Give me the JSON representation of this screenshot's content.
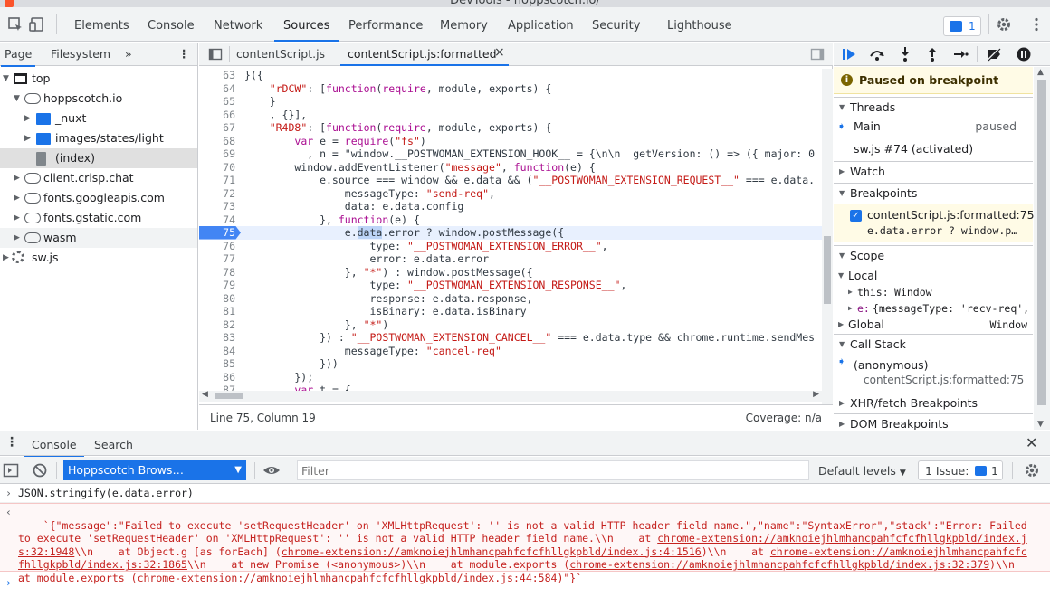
{
  "window": {
    "title": "DevTools - hoppscotch.io/"
  },
  "main_tabs": [
    "Elements",
    "Console",
    "Network",
    "Sources",
    "Performance",
    "Memory",
    "Application",
    "Security",
    "Lighthouse"
  ],
  "issues_badge": "1",
  "navigator": {
    "tabs": [
      "Page",
      "Filesystem"
    ],
    "overflow": "»",
    "tree": [
      {
        "label": "top"
      },
      {
        "label": "hoppscotch.io"
      },
      {
        "label": "_nuxt"
      },
      {
        "label": "images/states/light"
      },
      {
        "label": "(index)"
      },
      {
        "label": "client.crisp.chat"
      },
      {
        "label": "fonts.googleapis.com"
      },
      {
        "label": "fonts.gstatic.com"
      },
      {
        "label": "wasm"
      },
      {
        "label": "sw.js"
      }
    ]
  },
  "editor": {
    "tabs": [
      "contentScript.js",
      "contentScript.js:formatted"
    ],
    "close_icon": "×",
    "lines": [
      {
        "n": "63",
        "t": "}({"
      },
      {
        "n": "64",
        "t": "    \"rDCW\": [function(require, module, exports) {"
      },
      {
        "n": "65",
        "t": "    }"
      },
      {
        "n": "66",
        "t": "    , {}],"
      },
      {
        "n": "67",
        "t": "    \"R4D8\": [function(require, module, exports) {"
      },
      {
        "n": "68",
        "t": "        var e = require(\"fs\")"
      },
      {
        "n": "69",
        "t": "          , n = \"window.__POSTWOMAN_EXTENSION_HOOK__ = {\\n\\n  getVersion: () => ({ major: 0"
      },
      {
        "n": "70",
        "t": "        window.addEventListener(\"message\", function(e) {"
      },
      {
        "n": "71",
        "t": "            e.source === window && e.data && (\"__POSTWOMAN_EXTENSION_REQUEST__\" === e.data."
      },
      {
        "n": "72",
        "t": "                messageType: \"send-req\","
      },
      {
        "n": "73",
        "t": "                data: e.data.config"
      },
      {
        "n": "74",
        "t": "            }, function(e) {"
      },
      {
        "n": "75",
        "t": "                e.data.error ? window.postMessage({"
      },
      {
        "n": "76",
        "t": "                    type: \"__POSTWOMAN_EXTENSION_ERROR__\","
      },
      {
        "n": "77",
        "t": "                    error: e.data.error"
      },
      {
        "n": "78",
        "t": "                }, \"*\") : window.postMessage({"
      },
      {
        "n": "79",
        "t": "                    type: \"__POSTWOMAN_EXTENSION_RESPONSE__\","
      },
      {
        "n": "80",
        "t": "                    response: e.data.response,"
      },
      {
        "n": "81",
        "t": "                    isBinary: e.data.isBinary"
      },
      {
        "n": "82",
        "t": "                }, \"*\")"
      },
      {
        "n": "83",
        "t": "            }) : \"__POSTWOMAN_EXTENSION_CANCEL__\" === e.data.type && chrome.runtime.sendMes"
      },
      {
        "n": "84",
        "t": "                messageType: \"cancel-req\""
      },
      {
        "n": "85",
        "t": "            }))"
      },
      {
        "n": "86",
        "t": "        });"
      },
      {
        "n": "87",
        "t": "        var t = {"
      }
    ],
    "status_position": "Line 75, Column 19",
    "status_coverage": "Coverage: n/a"
  },
  "debugger": {
    "paused_text": "Paused on breakpoint",
    "threads_title": "Threads",
    "thread_main": "Main",
    "thread_main_state": "paused",
    "thread_sw": "sw.js #74 (activated)",
    "watch_title": "Watch",
    "breakpoints_title": "Breakpoints",
    "breakpoint_file": "contentScript.js:formatted:75",
    "breakpoint_code": "e.data.error ? window.p…",
    "scope_title": "Scope",
    "scope_local": "Local",
    "scope_this_key": "this:",
    "scope_this_val": "Window",
    "scope_e_key": "e:",
    "scope_e_val": "{messageType: 'recv-req',",
    "scope_global": "Global",
    "scope_global_val": "Window",
    "callstack_title": "Call Stack",
    "callstack_fn": "(anonymous)",
    "callstack_loc": "contentScript.js:formatted:75",
    "xhr_title": "XHR/fetch Breakpoints",
    "dom_title": "DOM Breakpoints"
  },
  "drawer": {
    "tabs": [
      "Console",
      "Search"
    ],
    "context": "Hoppscotch Brows…",
    "filter_placeholder": "Filter",
    "levels": "Default levels",
    "issues_label": "1 Issue:",
    "issues_count": "1"
  },
  "console": {
    "input": "JSON.stringify(e.data.error)",
    "result_parts": [
      {
        "text": "`{\"message\":\"Failed to execute 'setRequestHeader' on 'XMLHttpRequest': '' is not a valid HTTP header field name.\",\"name\":\"SyntaxError\",\"stack\":\"Error: Failed to execute 'setRequestHeader' on 'XMLHttpRequest': '' is not a valid HTTP header field name.\\\\n    at ",
        "link": false
      },
      {
        "text": "chrome-extension://amknoiejhlmhancpahfcfcfhllgkpbld/index.js:32:1948",
        "link": true
      },
      {
        "text": "\\\\n    at Object.g [as forEach] (",
        "link": false
      },
      {
        "text": "chrome-extension://amknoiejhlmhancpahfcfcfhllgkpbld/index.js:4:1516",
        "link": true
      },
      {
        "text": ")\\\\n    at ",
        "link": false
      },
      {
        "text": "chrome-extension://amknoiejhlmhancpahfcfcfhllgkpbld/index.js:32:1865",
        "link": true
      },
      {
        "text": "\\\\n    at new Promise (<anonymous>)\\\\n    at module.exports (",
        "link": false
      },
      {
        "text": "chrome-extension://amknoiejhlmhancpahfcfcfhllgkpbld/index.js:32:379",
        "link": true
      },
      {
        "text": ")\\\\n    at module.exports (",
        "link": false
      },
      {
        "text": "chrome-extension://amknoiejhlmhancpahfcfcfhllgkpbld/index.js:44:584",
        "link": true
      },
      {
        "text": ")\"}`",
        "link": false
      }
    ]
  },
  "colors": {
    "accent": "#1a73e8",
    "error": "#c5221f",
    "string": "#c41a16",
    "keyword": "#aa0d91"
  }
}
